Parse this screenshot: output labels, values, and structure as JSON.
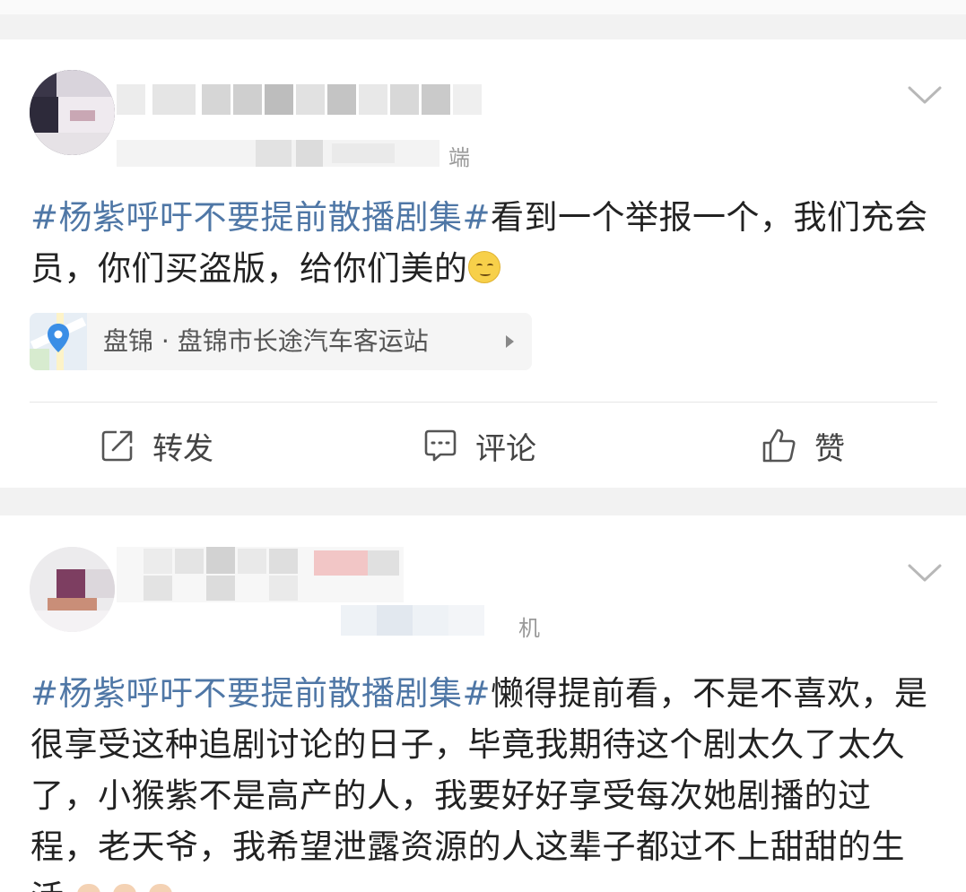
{
  "feed": {
    "posts": [
      {
        "username_visible_tail": "",
        "source_visible_tail": "端",
        "text_topic": "#杨紫呼吁不要提前散播剧集#",
        "text_body": "看到一个举报一个，我们充会员，你们买盗版，给你们美的",
        "emoji": "smirk-face",
        "location": {
          "label": "盘锦 · 盘锦市长途汽车客运站",
          "icon": "location-pin-icon"
        },
        "actions": {
          "repost": "转发",
          "comment": "评论",
          "like": "赞"
        }
      },
      {
        "source_visible_tail": "机",
        "text_topic": "#杨紫呼吁不要提前散播剧集#",
        "text_body": "懒得提前看，不是不喜欢，是很享受这种追剧讨论的日子，毕竟我期待这个剧太久了太久了，小猴紫不是高产的人，我要好好享受每次她剧播的过程，老天爷，我希望泄露资源的人这辈子都过不上甜甜的生活",
        "emoji": "praying-hands"
      }
    ]
  },
  "colors": {
    "topic": "#4f77a6",
    "text": "#222222",
    "background": "#f2f2f2",
    "card": "#ffffff"
  }
}
